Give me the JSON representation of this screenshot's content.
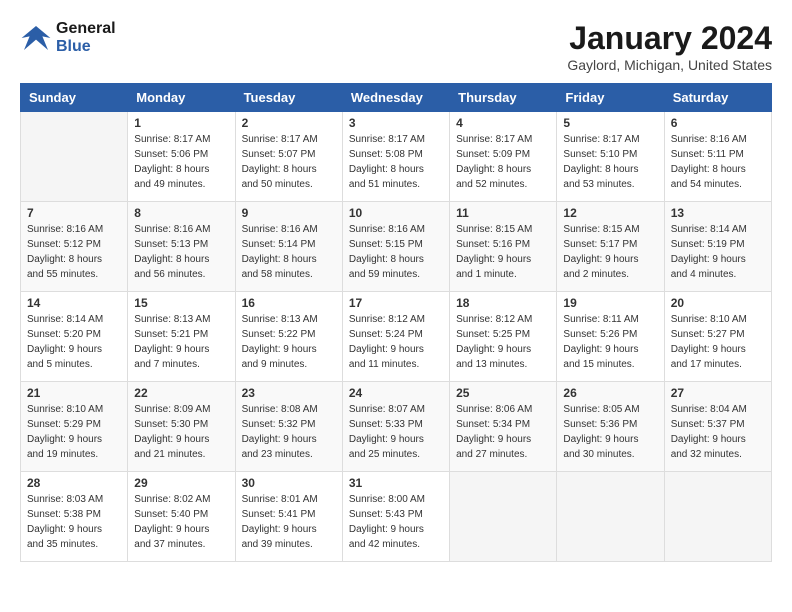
{
  "header": {
    "logo_line1": "General",
    "logo_line2": "Blue",
    "title": "January 2024",
    "subtitle": "Gaylord, Michigan, United States"
  },
  "calendar": {
    "days_of_week": [
      "Sunday",
      "Monday",
      "Tuesday",
      "Wednesday",
      "Thursday",
      "Friday",
      "Saturday"
    ],
    "weeks": [
      [
        {
          "day": "",
          "info": ""
        },
        {
          "day": "1",
          "info": "Sunrise: 8:17 AM\nSunset: 5:06 PM\nDaylight: 8 hours\nand 49 minutes."
        },
        {
          "day": "2",
          "info": "Sunrise: 8:17 AM\nSunset: 5:07 PM\nDaylight: 8 hours\nand 50 minutes."
        },
        {
          "day": "3",
          "info": "Sunrise: 8:17 AM\nSunset: 5:08 PM\nDaylight: 8 hours\nand 51 minutes."
        },
        {
          "day": "4",
          "info": "Sunrise: 8:17 AM\nSunset: 5:09 PM\nDaylight: 8 hours\nand 52 minutes."
        },
        {
          "day": "5",
          "info": "Sunrise: 8:17 AM\nSunset: 5:10 PM\nDaylight: 8 hours\nand 53 minutes."
        },
        {
          "day": "6",
          "info": "Sunrise: 8:16 AM\nSunset: 5:11 PM\nDaylight: 8 hours\nand 54 minutes."
        }
      ],
      [
        {
          "day": "7",
          "info": "Sunrise: 8:16 AM\nSunset: 5:12 PM\nDaylight: 8 hours\nand 55 minutes."
        },
        {
          "day": "8",
          "info": "Sunrise: 8:16 AM\nSunset: 5:13 PM\nDaylight: 8 hours\nand 56 minutes."
        },
        {
          "day": "9",
          "info": "Sunrise: 8:16 AM\nSunset: 5:14 PM\nDaylight: 8 hours\nand 58 minutes."
        },
        {
          "day": "10",
          "info": "Sunrise: 8:16 AM\nSunset: 5:15 PM\nDaylight: 8 hours\nand 59 minutes."
        },
        {
          "day": "11",
          "info": "Sunrise: 8:15 AM\nSunset: 5:16 PM\nDaylight: 9 hours\nand 1 minute."
        },
        {
          "day": "12",
          "info": "Sunrise: 8:15 AM\nSunset: 5:17 PM\nDaylight: 9 hours\nand 2 minutes."
        },
        {
          "day": "13",
          "info": "Sunrise: 8:14 AM\nSunset: 5:19 PM\nDaylight: 9 hours\nand 4 minutes."
        }
      ],
      [
        {
          "day": "14",
          "info": "Sunrise: 8:14 AM\nSunset: 5:20 PM\nDaylight: 9 hours\nand 5 minutes."
        },
        {
          "day": "15",
          "info": "Sunrise: 8:13 AM\nSunset: 5:21 PM\nDaylight: 9 hours\nand 7 minutes."
        },
        {
          "day": "16",
          "info": "Sunrise: 8:13 AM\nSunset: 5:22 PM\nDaylight: 9 hours\nand 9 minutes."
        },
        {
          "day": "17",
          "info": "Sunrise: 8:12 AM\nSunset: 5:24 PM\nDaylight: 9 hours\nand 11 minutes."
        },
        {
          "day": "18",
          "info": "Sunrise: 8:12 AM\nSunset: 5:25 PM\nDaylight: 9 hours\nand 13 minutes."
        },
        {
          "day": "19",
          "info": "Sunrise: 8:11 AM\nSunset: 5:26 PM\nDaylight: 9 hours\nand 15 minutes."
        },
        {
          "day": "20",
          "info": "Sunrise: 8:10 AM\nSunset: 5:27 PM\nDaylight: 9 hours\nand 17 minutes."
        }
      ],
      [
        {
          "day": "21",
          "info": "Sunrise: 8:10 AM\nSunset: 5:29 PM\nDaylight: 9 hours\nand 19 minutes."
        },
        {
          "day": "22",
          "info": "Sunrise: 8:09 AM\nSunset: 5:30 PM\nDaylight: 9 hours\nand 21 minutes."
        },
        {
          "day": "23",
          "info": "Sunrise: 8:08 AM\nSunset: 5:32 PM\nDaylight: 9 hours\nand 23 minutes."
        },
        {
          "day": "24",
          "info": "Sunrise: 8:07 AM\nSunset: 5:33 PM\nDaylight: 9 hours\nand 25 minutes."
        },
        {
          "day": "25",
          "info": "Sunrise: 8:06 AM\nSunset: 5:34 PM\nDaylight: 9 hours\nand 27 minutes."
        },
        {
          "day": "26",
          "info": "Sunrise: 8:05 AM\nSunset: 5:36 PM\nDaylight: 9 hours\nand 30 minutes."
        },
        {
          "day": "27",
          "info": "Sunrise: 8:04 AM\nSunset: 5:37 PM\nDaylight: 9 hours\nand 32 minutes."
        }
      ],
      [
        {
          "day": "28",
          "info": "Sunrise: 8:03 AM\nSunset: 5:38 PM\nDaylight: 9 hours\nand 35 minutes."
        },
        {
          "day": "29",
          "info": "Sunrise: 8:02 AM\nSunset: 5:40 PM\nDaylight: 9 hours\nand 37 minutes."
        },
        {
          "day": "30",
          "info": "Sunrise: 8:01 AM\nSunset: 5:41 PM\nDaylight: 9 hours\nand 39 minutes."
        },
        {
          "day": "31",
          "info": "Sunrise: 8:00 AM\nSunset: 5:43 PM\nDaylight: 9 hours\nand 42 minutes."
        },
        {
          "day": "",
          "info": ""
        },
        {
          "day": "",
          "info": ""
        },
        {
          "day": "",
          "info": ""
        }
      ]
    ]
  }
}
